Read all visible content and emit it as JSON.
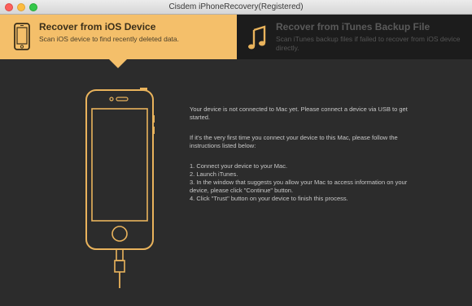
{
  "window": {
    "title": "Cisdem iPhoneRecovery(Registered)"
  },
  "tabs": {
    "ios": {
      "title": "Recover from iOS Device",
      "description": "Scan iOS device to find recently deleted data.",
      "icon": "iphone-icon",
      "selected": true
    },
    "itunes": {
      "title": "Recover from iTunes Backup File",
      "description": "Scan iTunes backup files if failed to recover from iOS device directly.",
      "icon": "music-note-icon",
      "selected": false
    }
  },
  "main": {
    "phone_illustration": "iphone-with-cable-icon",
    "status_message": "Your device is not connected to Mac yet. Please connect a device via USB to get started.",
    "first_time_message": "If it's the very first time you connect your device to this Mac, please follow the instructions listed below:",
    "steps": [
      "1. Connect your device to your Mac.",
      "2. Launch iTunes.",
      "3. In the window that suggests you allow your Mac to access information on your device, please click \"Continue\" button.",
      "4. Click \"Trust\" button on your device to finish this process."
    ]
  },
  "colors": {
    "accent": "#f4bf6a",
    "background": "#2c2c2c",
    "inactive_tab": "#1c1c1c",
    "text": "#c8c8c8"
  }
}
